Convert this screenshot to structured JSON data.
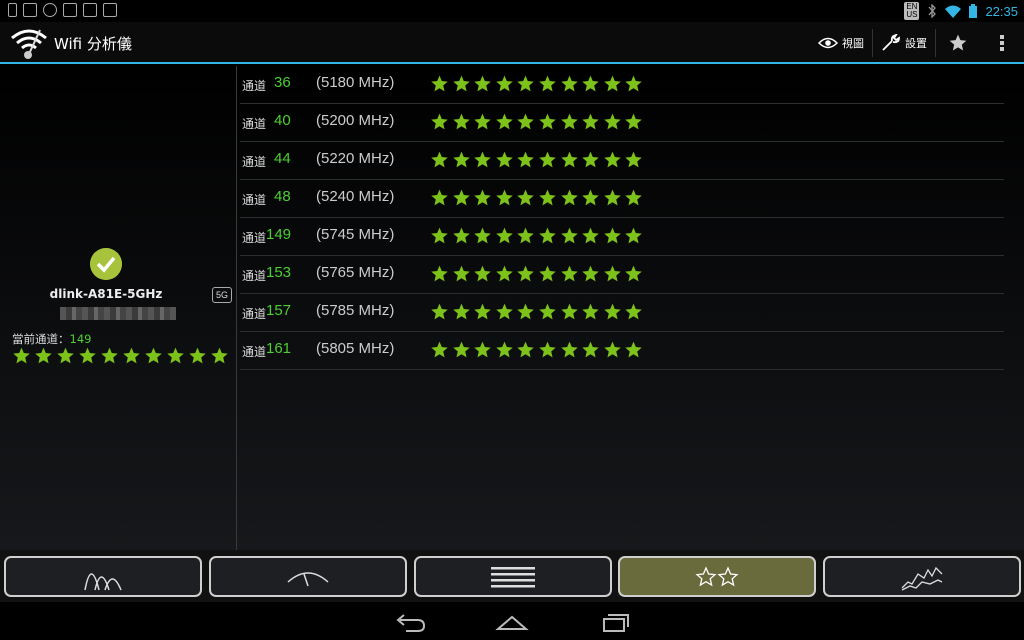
{
  "status_bar": {
    "time": "22:35",
    "lang_top": "EN",
    "lang_bottom": "US",
    "left_icons": [
      "phone-notify-icon",
      "image-icon",
      "eye-icon",
      "mail-icon",
      "bag-icon",
      "bag-play-icon"
    ],
    "right_icons": [
      "language-icon",
      "bluetooth-off-icon",
      "wifi-icon",
      "battery-icon"
    ]
  },
  "action_bar": {
    "title": "Wifi 分析儀",
    "view_label": "視圖",
    "settings_label": "設置",
    "accent": "#33b5e5"
  },
  "current_network": {
    "ssid": "dlink-A81E-5GHz",
    "band": "5G",
    "current_channel_label": "當前通道：",
    "current_channel": "149",
    "rating": 10,
    "rating_max": 10
  },
  "channel_label": "通道",
  "channels": [
    {
      "channel": "36",
      "freq": "(5180 MHz)",
      "rating": 10
    },
    {
      "channel": "40",
      "freq": "(5200 MHz)",
      "rating": 10
    },
    {
      "channel": "44",
      "freq": "(5220 MHz)",
      "rating": 10
    },
    {
      "channel": "48",
      "freq": "(5240 MHz)",
      "rating": 10
    },
    {
      "channel": "149",
      "freq": "(5745 MHz)",
      "rating": 10
    },
    {
      "channel": "153",
      "freq": "(5765 MHz)",
      "rating": 10
    },
    {
      "channel": "157",
      "freq": "(5785 MHz)",
      "rating": 10
    },
    {
      "channel": "161",
      "freq": "(5805 MHz)",
      "rating": 10
    }
  ],
  "tabs": [
    {
      "name": "channel-graph",
      "icon": "channel-graph-icon",
      "active": false
    },
    {
      "name": "signal-meter",
      "icon": "signal-meter-icon",
      "active": false
    },
    {
      "name": "ap-list",
      "icon": "list-icon",
      "active": false
    },
    {
      "name": "channel-rating",
      "icon": "two-stars-icon",
      "active": true
    },
    {
      "name": "time-graph",
      "icon": "time-graph-icon",
      "active": false
    }
  ],
  "colors": {
    "star": "#7cc21b",
    "channel_number": "#4ccf32",
    "active_tab": "#6a6b3d"
  }
}
